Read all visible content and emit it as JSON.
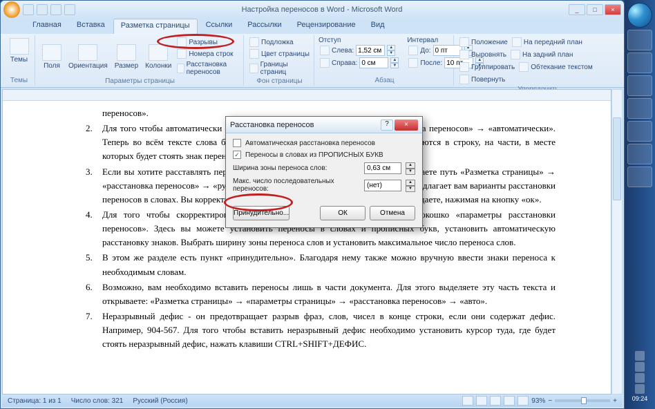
{
  "window": {
    "title": "Настройка переносов в Word - Microsoft Word",
    "min": "_",
    "max": "□",
    "close": "×"
  },
  "tabs": {
    "t0": "Главная",
    "t1": "Вставка",
    "t2": "Разметка страницы",
    "t3": "Ссылки",
    "t4": "Рассылки",
    "t5": "Рецензирование",
    "t6": "Вид"
  },
  "ribbon": {
    "themes": {
      "btn": "Темы",
      "label": "Темы"
    },
    "pagesetup": {
      "fields": "Поля",
      "orient": "Ориентация",
      "size": "Размер",
      "cols": "Колонки",
      "breaks": "Разрывы",
      "lines": "Номера строк",
      "hyph": "Расстановка переносов",
      "label": "Параметры страницы"
    },
    "bg": {
      "wm": "Подложка",
      "color": "Цвет страницы",
      "border": "Границы страниц",
      "label": "Фон страницы"
    },
    "indent": {
      "header": "Отступ",
      "left_lbl": "Слева:",
      "left_val": "1,52 см",
      "right_lbl": "Справа:",
      "right_val": "0 см"
    },
    "spacing": {
      "header": "Интервал",
      "before_lbl": "До:",
      "before_val": "0 пт",
      "after_lbl": "После:",
      "after_val": "10 пт",
      "label": "Абзац"
    },
    "arrange": {
      "pos": "Положение",
      "front": "На передний план",
      "back": "На задний план",
      "wrap": "Обтекание текстом",
      "align": "Выровнять",
      "group": "Группировать",
      "rotate": "Повернуть",
      "label": "Упорядочить"
    }
  },
  "dialog": {
    "title": "Расстановка переносов",
    "auto": "Автоматическая расстановка переносов",
    "caps": "Переносы в словах из ПРОПИСНЫХ БУКВ",
    "zone_lbl": "Ширина зоны переноса слов:",
    "zone_val": "0,63 см",
    "max_lbl": "Макс. число последовательных переносов:",
    "max_val": "(нет)",
    "force": "Принудительно...",
    "ok": "ОК",
    "cancel": "Отмена",
    "help": "?",
    "close": "×"
  },
  "doc": {
    "l1_top": "переносов».",
    "l2": "Для того чтобы автоматически расставить переносы, выбираете путь «расстановка переносов» → «автоматически». Теперь во всём тексте слова будут разбиваться, которые полностью не помещаются в строку, на части, в месте которых будет стоять знак переноса.",
    "l3": "Если вы хотите расставлять переносы в отдельных словах самостоятельно выбираете путь «Разметка страницы» → «расстановка переносов» → «ручной режим». Здесь Microsoft Office Word 2007 предлагает вам варианты расстановки переносов в словах. Вы корректируете, исправляете (если необходимо) и подтверждаете, нажимая на кнопку «ок».",
    "l4": "Для того чтобы скорректировать работу данного раздела можно открыть окошко «параметры расстановки переносов». Здесь вы можете установить переносы в словах и прописных букв, установить автоматическую расстановку знаков. Выбрать ширину зоны переноса слов и установить максимальное число переноса слов.",
    "l5": "В этом же разделе есть пункт «принудительно». Благодаря нему также можно вручную ввести знаки переноса к необходимым словам.",
    "l6": "Возможно, вам необходимо вставить переносы лишь в части документа. Для этого выделяете эту часть текста и открываете: «Разметка страницы» → «параметры страницы» → «расстановка переносов» → «авто».",
    "l7": "Неразрывный дефис - он предотвращает разрыв фраз, слов, чисел в конце строки, если они содержат дефис. Например, 904-567. Для того чтобы вставить неразрывный дефис необходимо установить курсор туда, где будет стоять неразрывный дефис, нажать клавиши CTRL+SHIFT+ДЕФИС.",
    "n2": "2.",
    "n3": "3.",
    "n4": "4.",
    "n5": "5.",
    "n6": "6.",
    "n7": "7."
  },
  "status": {
    "page": "Страница: 1 из 1",
    "words": "Число слов: 321",
    "lang": "Русский (Россия)",
    "zoom": "93%",
    "zoom_minus": "−",
    "zoom_plus": "+"
  },
  "clock": {
    "time": "09:24"
  }
}
